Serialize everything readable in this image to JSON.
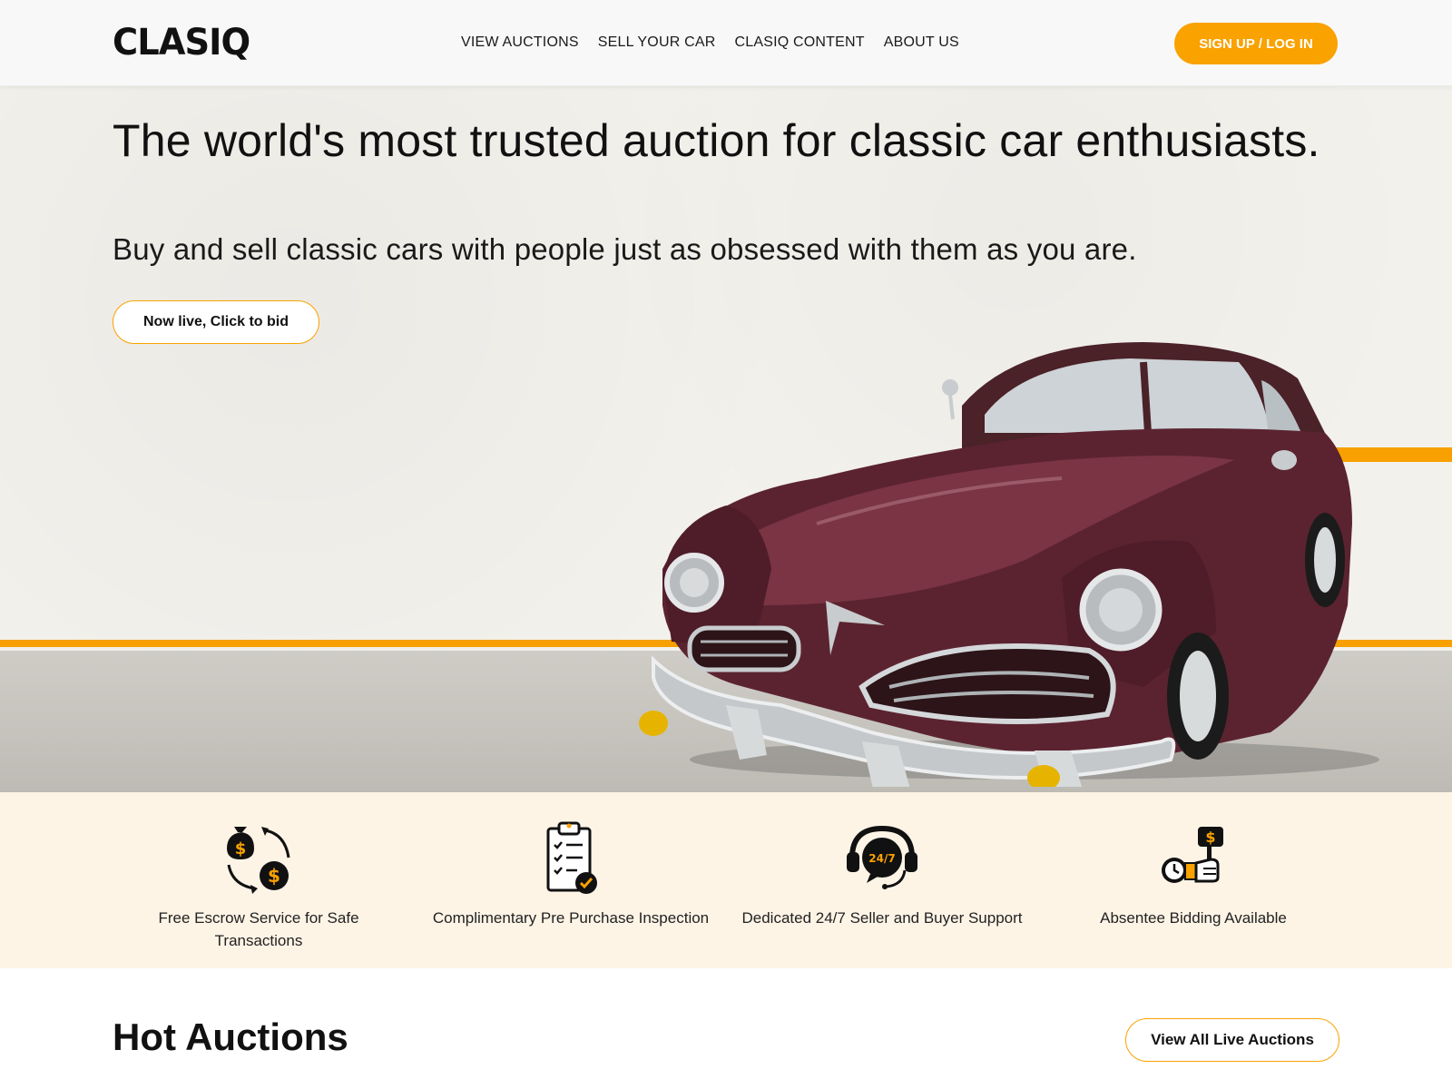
{
  "brand": {
    "logo_text": "CLASIQ",
    "accent_color": "#F9A200",
    "accent_light_bg": "#FDF4E6"
  },
  "nav": {
    "items": [
      {
        "label": "VIEW AUCTIONS"
      },
      {
        "label": "SELL YOUR CAR"
      },
      {
        "label": "CLASIQ CONTENT"
      },
      {
        "label": "ABOUT US"
      }
    ],
    "signup_label": "SIGN UP / LOG IN"
  },
  "hero": {
    "title": "The world's most trusted auction for classic car enthusiasts.",
    "subtitle": "Buy and sell classic cars with people just as obsessed with them as you are.",
    "cta_label": "Now live, Click to bid"
  },
  "features": [
    {
      "icon": "money-exchange-icon",
      "label": "Free Escrow Service for Safe Transactions"
    },
    {
      "icon": "checklist-icon",
      "label": "Complimentary Pre Purchase Inspection"
    },
    {
      "icon": "support-24-7-icon",
      "label": "Dedicated 24/7 Seller and Buyer Support",
      "icon_text": "24/7"
    },
    {
      "icon": "absentee-bid-icon",
      "label": "Absentee Bidding Available"
    }
  ],
  "hot_auctions": {
    "title": "Hot Auctions",
    "view_all_label": "View All Live Auctions"
  }
}
